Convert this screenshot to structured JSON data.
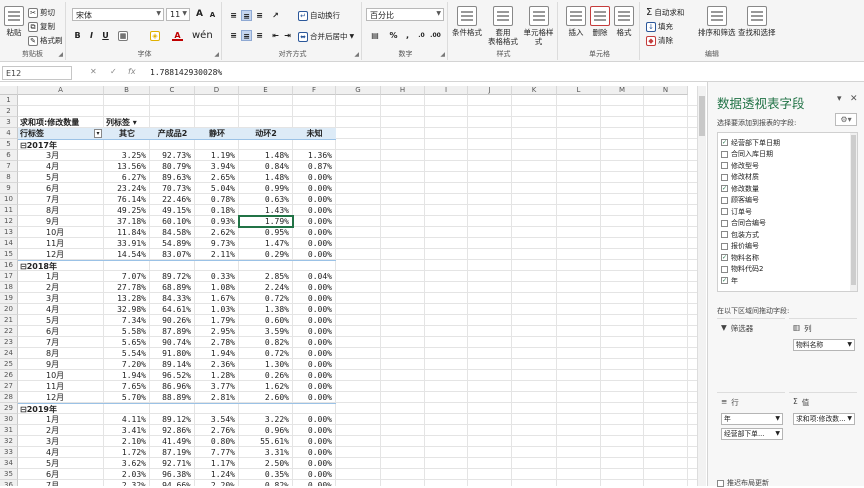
{
  "ribbon": {
    "clipboard": {
      "paste": "粘贴",
      "cut": "剪切",
      "copy": "复制",
      "format_painter": "格式刷",
      "label": "剪贴板"
    },
    "font": {
      "name": "宋体",
      "size": "11",
      "label": "字体",
      "bold": "B",
      "italic": "I",
      "underline": "U",
      "grow": "A",
      "shrink": "A",
      "font_color_glyph": "A"
    },
    "alignment": {
      "wrap": "自动换行",
      "merge": "合并后居中",
      "label": "对齐方式"
    },
    "number": {
      "format": "百分比",
      "percent": "%",
      "comma": ",",
      "label": "数字"
    },
    "styles": {
      "conditional": "条件格式",
      "table": "套用\n表格格式",
      "cell": "单元格样式",
      "label": "样式"
    },
    "cells": {
      "insert": "插入",
      "delete": "删除",
      "format": "格式",
      "label": "单元格"
    },
    "editing": {
      "autosum": "自动求和",
      "fill": "填充",
      "clear": "清除",
      "sort": "排序和筛选",
      "find": "查找和选择",
      "label": "编辑"
    }
  },
  "formula": {
    "name_box": "E12",
    "value": "1.788142930028%"
  },
  "columns": [
    "A",
    "B",
    "C",
    "D",
    "E",
    "F",
    "G",
    "H",
    "I",
    "J",
    "K",
    "L",
    "M",
    "N"
  ],
  "pivot": {
    "title": "求和项:修改数量",
    "col_label": "列标签",
    "row_label": "行标签",
    "headers": [
      "其它",
      "产成品2",
      "静环",
      "动环2",
      "未知"
    ],
    "rows": [
      {
        "r": 5,
        "label": "2017年",
        "year": true
      },
      {
        "r": 6,
        "label": "3月",
        "v": [
          "3.25%",
          "92.73%",
          "1.19%",
          "1.48%",
          "1.36%"
        ]
      },
      {
        "r": 7,
        "label": "4月",
        "v": [
          "13.56%",
          "80.79%",
          "3.94%",
          "0.84%",
          "0.87%"
        ]
      },
      {
        "r": 8,
        "label": "5月",
        "v": [
          "6.27%",
          "89.63%",
          "2.65%",
          "1.48%",
          "0.00%"
        ]
      },
      {
        "r": 9,
        "label": "6月",
        "v": [
          "23.24%",
          "70.73%",
          "5.04%",
          "0.99%",
          "0.00%"
        ]
      },
      {
        "r": 10,
        "label": "7月",
        "v": [
          "76.14%",
          "22.46%",
          "0.78%",
          "0.63%",
          "0.00%"
        ]
      },
      {
        "r": 11,
        "label": "8月",
        "v": [
          "49.25%",
          "49.15%",
          "0.18%",
          "1.43%",
          "0.00%"
        ]
      },
      {
        "r": 12,
        "label": "9月",
        "v": [
          "37.18%",
          "60.10%",
          "0.93%",
          "1.79%",
          "0.00%"
        ]
      },
      {
        "r": 13,
        "label": "10月",
        "v": [
          "11.84%",
          "84.58%",
          "2.62%",
          "0.95%",
          "0.00%"
        ]
      },
      {
        "r": 14,
        "label": "11月",
        "v": [
          "33.91%",
          "54.89%",
          "9.73%",
          "1.47%",
          "0.00%"
        ]
      },
      {
        "r": 15,
        "label": "12月",
        "v": [
          "14.54%",
          "83.07%",
          "2.11%",
          "0.29%",
          "0.00%"
        ]
      },
      {
        "r": 16,
        "label": "2018年",
        "year": true
      },
      {
        "r": 17,
        "label": "1月",
        "v": [
          "7.07%",
          "89.72%",
          "0.33%",
          "2.85%",
          "0.04%"
        ]
      },
      {
        "r": 18,
        "label": "2月",
        "v": [
          "27.78%",
          "68.89%",
          "1.08%",
          "2.24%",
          "0.00%"
        ]
      },
      {
        "r": 19,
        "label": "3月",
        "v": [
          "13.28%",
          "84.33%",
          "1.67%",
          "0.72%",
          "0.00%"
        ]
      },
      {
        "r": 20,
        "label": "4月",
        "v": [
          "32.98%",
          "64.61%",
          "1.03%",
          "1.38%",
          "0.00%"
        ]
      },
      {
        "r": 21,
        "label": "5月",
        "v": [
          "7.34%",
          "90.26%",
          "1.79%",
          "0.60%",
          "0.00%"
        ]
      },
      {
        "r": 22,
        "label": "6月",
        "v": [
          "5.58%",
          "87.89%",
          "2.95%",
          "3.59%",
          "0.00%"
        ]
      },
      {
        "r": 23,
        "label": "7月",
        "v": [
          "5.65%",
          "90.74%",
          "2.78%",
          "0.82%",
          "0.00%"
        ]
      },
      {
        "r": 24,
        "label": "8月",
        "v": [
          "5.54%",
          "91.80%",
          "1.94%",
          "0.72%",
          "0.00%"
        ]
      },
      {
        "r": 25,
        "label": "9月",
        "v": [
          "7.20%",
          "89.14%",
          "2.36%",
          "1.30%",
          "0.00%"
        ]
      },
      {
        "r": 26,
        "label": "10月",
        "v": [
          "1.94%",
          "96.52%",
          "1.28%",
          "0.26%",
          "0.00%"
        ]
      },
      {
        "r": 27,
        "label": "11月",
        "v": [
          "7.65%",
          "86.96%",
          "3.77%",
          "1.62%",
          "0.00%"
        ]
      },
      {
        "r": 28,
        "label": "12月",
        "v": [
          "5.70%",
          "88.89%",
          "2.81%",
          "2.60%",
          "0.00%"
        ]
      },
      {
        "r": 29,
        "label": "2019年",
        "year": true
      },
      {
        "r": 30,
        "label": "1月",
        "v": [
          "4.11%",
          "89.12%",
          "3.54%",
          "3.22%",
          "0.00%"
        ]
      },
      {
        "r": 31,
        "label": "2月",
        "v": [
          "3.41%",
          "92.86%",
          "2.76%",
          "0.96%",
          "0.00%"
        ]
      },
      {
        "r": 32,
        "label": "3月",
        "v": [
          "2.10%",
          "41.49%",
          "0.80%",
          "55.61%",
          "0.00%"
        ]
      },
      {
        "r": 33,
        "label": "4月",
        "v": [
          "1.72%",
          "87.19%",
          "7.77%",
          "3.31%",
          "0.00%"
        ]
      },
      {
        "r": 34,
        "label": "5月",
        "v": [
          "3.62%",
          "92.71%",
          "1.17%",
          "2.50%",
          "0.00%"
        ]
      },
      {
        "r": 35,
        "label": "6月",
        "v": [
          "2.03%",
          "96.38%",
          "1.24%",
          "0.35%",
          "0.00%"
        ]
      },
      {
        "r": 36,
        "label": "7月",
        "v": [
          "2.32%",
          "94.66%",
          "2.20%",
          "0.82%",
          "0.00%"
        ]
      }
    ]
  },
  "pane": {
    "title": "数据透视表字段",
    "subtitle": "选择要添加到报表的字段:",
    "fields": [
      {
        "name": "经营部下单日期",
        "checked": true
      },
      {
        "name": "合同入库日期",
        "checked": false
      },
      {
        "name": "修改型号",
        "checked": false
      },
      {
        "name": "修改材质",
        "checked": false
      },
      {
        "name": "修改数量",
        "checked": true
      },
      {
        "name": "顾客编号",
        "checked": false
      },
      {
        "name": "订单号",
        "checked": false
      },
      {
        "name": "合同合编号",
        "checked": false
      },
      {
        "name": "包装方式",
        "checked": false
      },
      {
        "name": "报价编号",
        "checked": false
      },
      {
        "name": "物料名称",
        "checked": true
      },
      {
        "name": "物料代码2",
        "checked": false
      },
      {
        "name": "年",
        "checked": true
      }
    ],
    "drag_hint": "在以下区域间拖动字段:",
    "filter_label": "筛选器",
    "columns_label": "列",
    "rows_label": "行",
    "values_label": "值",
    "columns_items": [
      "物料名称"
    ],
    "rows_items": [
      "年",
      "经营部下单..."
    ],
    "values_items": [
      "求和项:修改数..."
    ],
    "defer": "推迟布局更新"
  }
}
